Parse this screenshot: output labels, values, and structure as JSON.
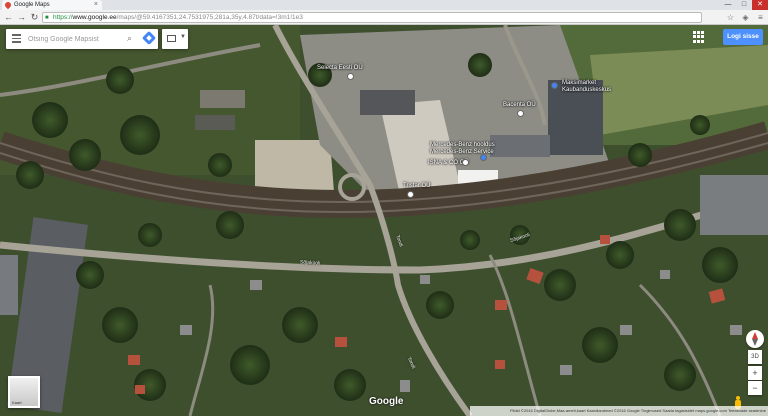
{
  "browser": {
    "tab_title": "Google Maps",
    "url_protocol": "https://",
    "url_host": "www.google.ee",
    "url_path": "/maps/@59.4167351,24.7531975,281a,35y,4.87t/data=!3m1!1e3",
    "win_min": "—",
    "win_max": "□",
    "win_close": "✕"
  },
  "search": {
    "placeholder": "Otsing Google Mapsist"
  },
  "header": {
    "signin_label": "Logi sisse"
  },
  "places": [
    {
      "label": "Selecta Eesti OÜ"
    },
    {
      "label": "Maksimarket Kaubanduskeskus"
    },
    {
      "label": "Bacenta OÜ"
    },
    {
      "label": "Mercedes-Benz hooldus Mercedes-Benz Service"
    },
    {
      "label": "ISNA & CO OÜ"
    },
    {
      "label": "Tristar OÜ"
    }
  ],
  "streets": [
    "Tondi",
    "Tondi",
    "Sõjakooli",
    "Sõjakooli"
  ],
  "map": {
    "earth_label": "Kaart",
    "google_logo": "Google",
    "footer_text": "Pildid ©2016 DigitalGlobe,Maa-ameti,kaart Kaardiandmed ©2016 Google   Tingimused   Saada tagasisidet   maps.google.com   Teeasnade seadmine",
    "zoom_in": "+",
    "zoom_out": "−",
    "view_3d": "3D"
  },
  "icons": {
    "back": "back-arrow-icon",
    "forward": "forward-arrow-icon",
    "reload": "reload-icon",
    "search": "search-icon",
    "directions": "directions-icon",
    "apps": "apps-grid-icon",
    "compass": "compass-icon",
    "pegman": "pegman-icon"
  }
}
